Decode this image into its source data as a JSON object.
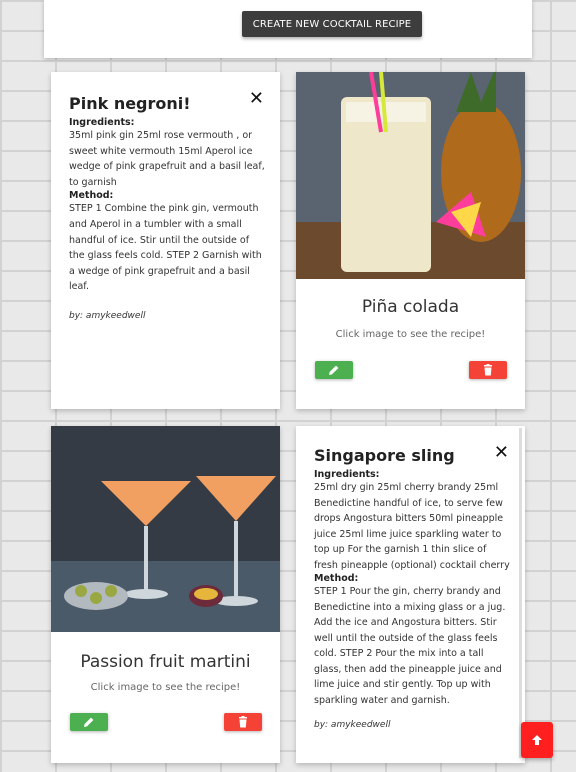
{
  "header": {
    "create_button": "CREATE NEW COCKTAIL RECIPE"
  },
  "labels": {
    "ingredients": "Ingredients:",
    "method": "Method:"
  },
  "cards": {
    "pink_negroni": {
      "title": "Pink negroni!",
      "ingredients": "35ml pink gin 25ml rose vermouth , or sweet white vermouth 15ml Aperol ice wedge of pink grapefruit and a basil leaf, to garnish",
      "method": "STEP 1 Combine the pink gin, vermouth and Aperol in a tumbler with a small handful of ice. Stir until the outside of the glass feels cold. STEP 2 Garnish with a wedge of pink grapefruit and a basil leaf.",
      "author": "by: amykeedwell"
    },
    "pina_colada": {
      "title": "Piña colada",
      "hint": "Click image to see the recipe!"
    },
    "passion_fruit": {
      "title": "Passion fruit martini",
      "hint": "Click image to see the recipe!"
    },
    "singapore_sling": {
      "title": "Singapore sling",
      "ingredients": "25ml dry gin 25ml cherry brandy 25ml Benedictine handful of ice, to serve few drops Angostura bitters 50ml pineapple juice 25ml lime juice sparkling water to top up For the garnish 1 thin slice of fresh pineapple (optional) cocktail cherry",
      "method": "STEP 1 Pour the gin, cherry brandy and Benedictine into a mixing glass or a jug. Add the ice and Angostura bitters. Stir well until the outside of the glass feels cold. STEP 2 Pour the mix into a tall glass, then add the pineapple juice and lime juice and stir gently. Top up with sparkling water and garnish.",
      "author": "by: amykeedwell"
    }
  },
  "icons": {
    "close": "close-icon",
    "edit": "pencil-icon",
    "delete": "trash-icon",
    "scroll_top": "arrow-up-icon"
  },
  "colors": {
    "edit_button": "#4caf50",
    "delete_button": "#f44336",
    "scroll_top_button": "#ff1f1f",
    "create_button": "#3d3d3d"
  }
}
